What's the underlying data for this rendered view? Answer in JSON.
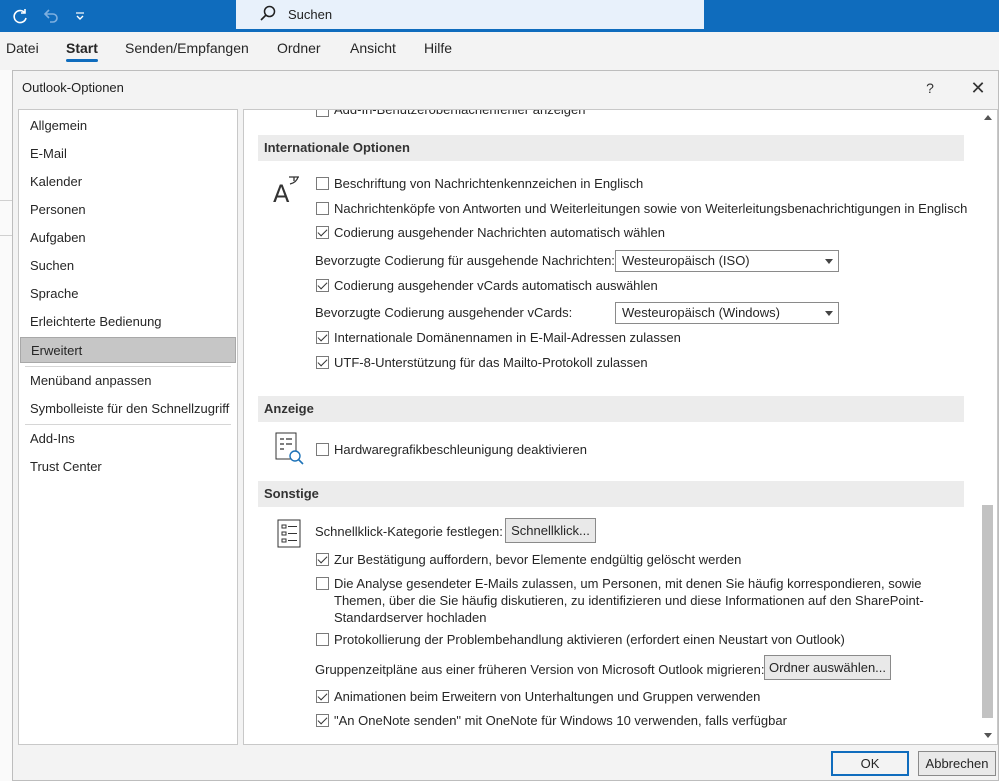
{
  "titlebar": {
    "search_placeholder": "Suchen",
    "icons": [
      "sync-icon",
      "undo-icon",
      "customize-quick-access-icon",
      "search-icon"
    ],
    "accent_color": "#0f6cbd"
  },
  "ribbon": {
    "tabs": [
      "Datei",
      "Start",
      "Senden/Empfangen",
      "Ordner",
      "Ansicht",
      "Hilfe"
    ],
    "active_tab": "Start"
  },
  "dialog": {
    "title": "Outlook-Optionen",
    "help_label": "?",
    "close_label": "✕",
    "ok_label": "OK",
    "cancel_label": "Abbrechen"
  },
  "nav": {
    "items": [
      "Allgemein",
      "E-Mail",
      "Kalender",
      "Personen",
      "Aufgaben",
      "Suchen",
      "Sprache",
      "Erleichterte Bedienung",
      "Erweitert",
      "Menüband anpassen",
      "Symbolleiste für den Schnellzugriff",
      "Add-Ins",
      "Trust Center"
    ],
    "selected": "Erweitert"
  },
  "main": {
    "top_cut_label": "Add-In-Benutzeroberflächenfehler anzeigen",
    "international": {
      "heading": "Internationale Optionen",
      "opt1": "Beschriftung von Nachrichtenkennzeichen in Englisch",
      "opt2": "Nachrichtenköpfe von Antworten und Weiterleitungen sowie von Weiterleitungsbenachrichtigungen in Englisch",
      "opt3": "Codierung ausgehender Nachrichten automatisch wählen",
      "pref_msg_label": "Bevorzugte Codierung für ausgehende Nachrichten:",
      "pref_msg_value": "Westeuropäisch (ISO)",
      "opt4": "Codierung ausgehender vCards automatisch auswählen",
      "pref_vcard_label": "Bevorzugte Codierung ausgehender vCards:",
      "pref_vcard_value": "Westeuropäisch (Windows)",
      "opt5": "Internationale Domänennamen in E-Mail-Adressen zulassen",
      "opt6": "UTF-8-Unterstützung für das Mailto-Protokoll zulassen",
      "checked": [
        false,
        false,
        true,
        true,
        true,
        true
      ]
    },
    "display": {
      "heading": "Anzeige",
      "opt1": "Hardwaregrafikbeschleunigung deaktivieren",
      "checked": [
        false
      ]
    },
    "other": {
      "heading": "Sonstige",
      "quickclick_label": "Schnellklick-Kategorie festlegen:",
      "quickclick_button": "Schnellklick...",
      "opt1": "Zur Bestätigung auffordern, bevor Elemente endgültig gelöscht werden",
      "opt2": "Die Analyse gesendeter E-Mails zulassen, um Personen, mit denen Sie häufig korrespondieren, sowie Themen, über die Sie häufig diskutieren, zu identifizieren und diese Informationen auf den SharePoint-Standardserver hochladen",
      "opt3": "Protokollierung der Problembehandlung aktivieren (erfordert einen Neustart von Outlook)",
      "migrate_label": "Gruppenzeitpläne aus einer früheren Version von Microsoft Outlook migrieren:",
      "migrate_button": "Ordner auswählen...",
      "opt4": "Animationen beim Erweitern von Unterhaltungen und Gruppen verwenden",
      "opt5": "\"An OneNote senden\" mit OneNote für Windows 10 verwenden, falls verfügbar",
      "checked": [
        true,
        false,
        false,
        true,
        true
      ]
    }
  }
}
